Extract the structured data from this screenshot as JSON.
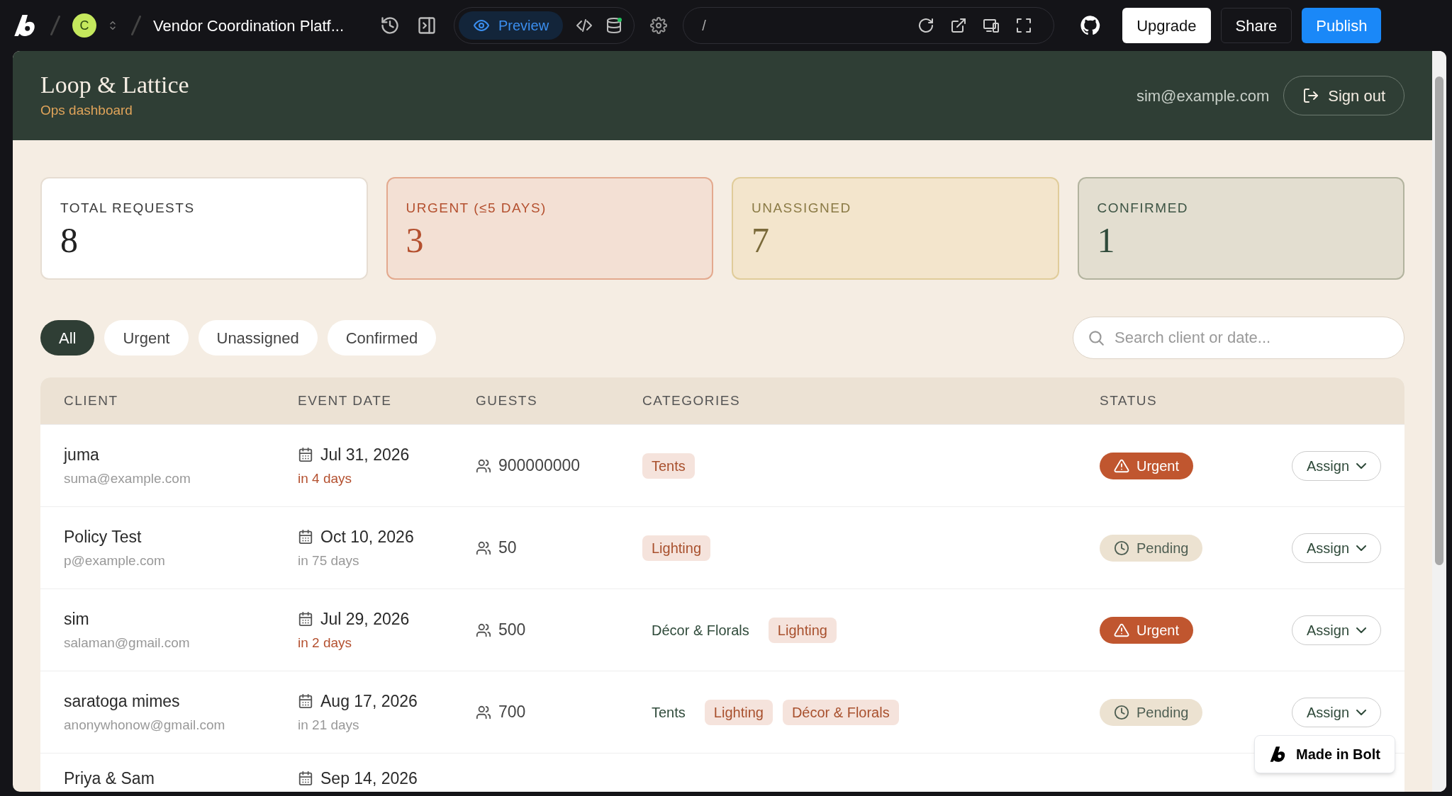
{
  "topbar": {
    "avatar_letter": "C",
    "project_title": "Vendor Coordination Platf...",
    "preview_tab": "Preview",
    "url": "/",
    "buttons": [
      {
        "label": "Upgrade",
        "kind": "light"
      },
      {
        "label": "Share",
        "kind": "dark"
      },
      {
        "label": "Publish",
        "kind": "primary"
      }
    ]
  },
  "header": {
    "brand": "Loop & Lattice",
    "subtitle": "Ops dashboard",
    "user_email": "sim@example.com",
    "sign_out": "Sign out"
  },
  "stats": [
    {
      "label": "TOTAL REQUESTS",
      "value": "8",
      "kind": "neutral"
    },
    {
      "label": "URGENT (≤5 DAYS)",
      "value": "3",
      "kind": "urgent"
    },
    {
      "label": "UNASSIGNED",
      "value": "7",
      "kind": "warning"
    },
    {
      "label": "CONFIRMED",
      "value": "1",
      "kind": "success"
    }
  ],
  "filters": [
    {
      "label": "All",
      "selected": true
    },
    {
      "label": "Urgent",
      "selected": false
    },
    {
      "label": "Unassigned",
      "selected": false
    },
    {
      "label": "Confirmed",
      "selected": false
    }
  ],
  "search": {
    "placeholder": "Search client or date..."
  },
  "table": {
    "columns": [
      "CLIENT",
      "EVENT DATE",
      "GUESTS",
      "CATEGORIES",
      "STATUS"
    ],
    "rows": [
      {
        "client": "juma",
        "email": "suma@example.com",
        "date": "Jul 31, 2026",
        "countdown": "in 4 days",
        "urgent": true,
        "guests": "900000000",
        "categories": [
          {
            "label": "Tents",
            "highlighted": true
          }
        ],
        "status": {
          "label": "Urgent",
          "kind": "urgent"
        },
        "action": "Assign"
      },
      {
        "client": "Policy Test",
        "email": "p@example.com",
        "date": "Oct 10, 2026",
        "countdown": "in 75 days",
        "urgent": false,
        "guests": "50",
        "categories": [
          {
            "label": "Lighting",
            "highlighted": true
          }
        ],
        "status": {
          "label": "Pending",
          "kind": "pending"
        },
        "action": "Assign"
      },
      {
        "client": "sim",
        "email": "salaman@gmail.com",
        "date": "Jul 29, 2026",
        "countdown": "in 2 days",
        "urgent": true,
        "guests": "500",
        "categories": [
          {
            "label": "Décor & Florals",
            "highlighted": false
          },
          {
            "label": "Lighting",
            "highlighted": true
          }
        ],
        "status": {
          "label": "Urgent",
          "kind": "urgent"
        },
        "action": "Assign"
      },
      {
        "client": "saratoga mimes",
        "email": "anonywhonow@gmail.com",
        "date": "Aug 17, 2026",
        "countdown": "in 21 days",
        "urgent": false,
        "guests": "700",
        "categories": [
          {
            "label": "Tents",
            "highlighted": false
          },
          {
            "label": "Lighting",
            "highlighted": true
          },
          {
            "label": "Décor & Florals",
            "highlighted": true
          }
        ],
        "status": {
          "label": "Pending",
          "kind": "pending"
        },
        "action": "Assign"
      },
      {
        "client": "Priya & Sam",
        "date": "Sep 14, 2026"
      }
    ]
  },
  "badge": "Made in Bolt"
}
